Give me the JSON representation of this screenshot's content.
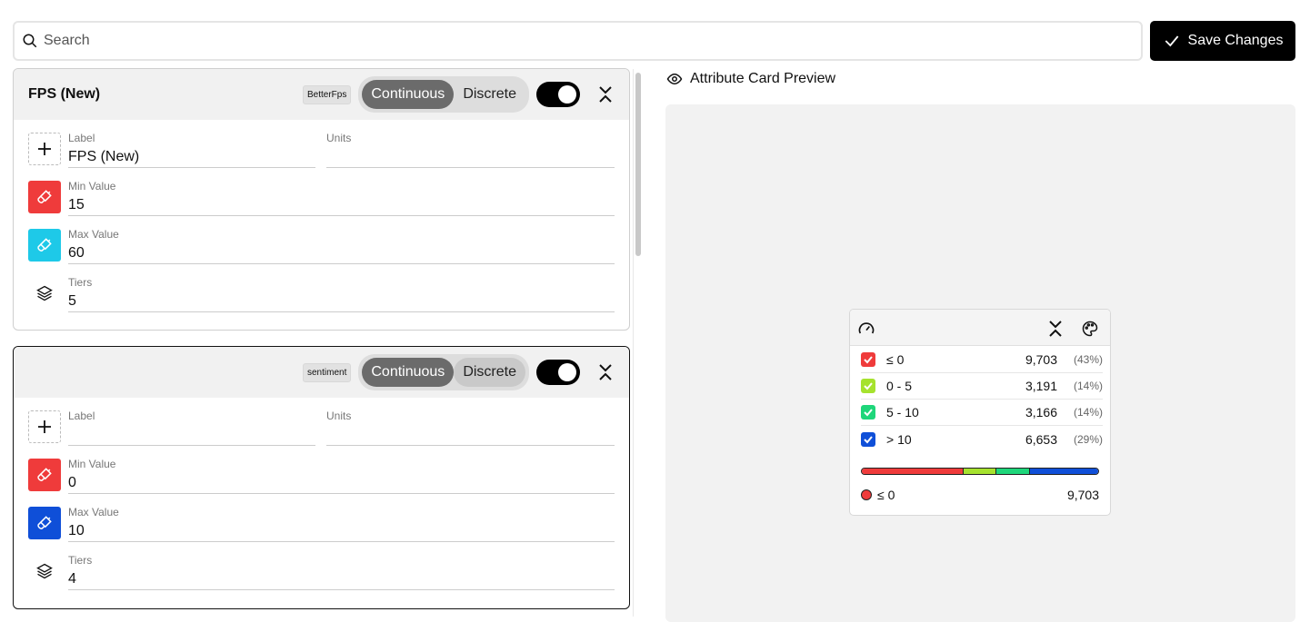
{
  "search": {
    "placeholder": "Search"
  },
  "toolbar": {
    "save_label": "Save Changes"
  },
  "cards": [
    {
      "title": "FPS (New)",
      "tag": "BetterFps",
      "mode_options": [
        "Continuous",
        "Discrete"
      ],
      "selected_mode": "Continuous",
      "enabled": true,
      "label": {
        "label": "Label",
        "value": "FPS (New)"
      },
      "units": {
        "label": "Units",
        "value": ""
      },
      "min": {
        "label": "Min Value",
        "value": "15",
        "color": "#ef3b3b"
      },
      "max": {
        "label": "Max Value",
        "value": "60",
        "color": "#1ec9e8"
      },
      "tiers": {
        "label": "Tiers",
        "value": "5"
      }
    },
    {
      "title": "",
      "tag": "sentiment",
      "mode_options": [
        "Continuous",
        "Discrete"
      ],
      "selected_mode": "Continuous",
      "enabled": true,
      "label": {
        "label": "Label",
        "value": ""
      },
      "units": {
        "label": "Units",
        "value": ""
      },
      "min": {
        "label": "Min Value",
        "value": "0",
        "color": "#ef3b3b"
      },
      "max": {
        "label": "Max Value",
        "value": "10",
        "color": "#0f4fd8"
      },
      "tiers": {
        "label": "Tiers",
        "value": "4"
      }
    }
  ],
  "preview": {
    "title": "Attribute Card Preview",
    "icons": [
      "gauge-icon",
      "collapse-icon",
      "palette-icon"
    ],
    "tiers": [
      {
        "name": "≤ 0",
        "count": "9,703",
        "pct": "(43%)",
        "color": "#ef3b3b",
        "share": 43
      },
      {
        "name": "0 - 5",
        "count": "3,191",
        "pct": "(14%)",
        "color": "#a6e22e",
        "share": 14
      },
      {
        "name": "5 - 10",
        "count": "3,166",
        "pct": "(14%)",
        "color": "#1ed67a",
        "share": 14
      },
      {
        "name": "> 10",
        "count": "6,653",
        "pct": "(29%)",
        "color": "#0f4fd8",
        "share": 29
      }
    ],
    "selected": {
      "name": "≤ 0",
      "count": "9,703",
      "color": "#ef3b3b"
    }
  }
}
